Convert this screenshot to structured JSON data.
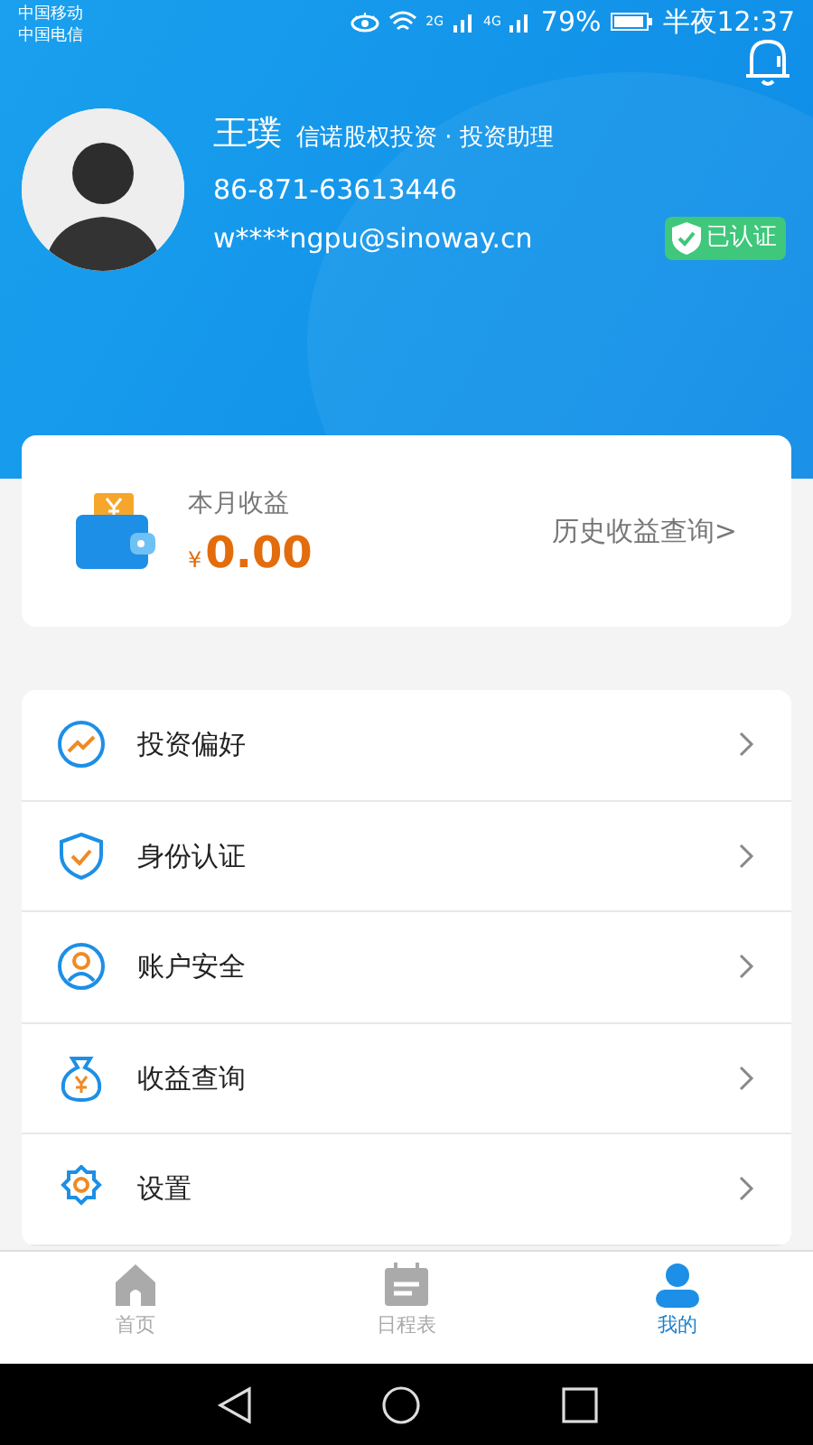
{
  "status_bar": {
    "carriers": [
      "中国移动",
      "中国电信"
    ],
    "network_1": "2G",
    "network_2": "4G",
    "battery": "79%",
    "time": "半夜12:37"
  },
  "profile": {
    "name": "王璞",
    "company": "信诺股权投资 · 投资助理",
    "phone": "86-871-63613446",
    "email": "w****ngpu@sinoway.cn",
    "verified_badge": "已认证"
  },
  "earnings": {
    "label": "本月收益",
    "currency": "¥",
    "amount": "0.00",
    "history_link": "历史收益查询>"
  },
  "menu": [
    {
      "label": "投资偏好"
    },
    {
      "label": "身份认证"
    },
    {
      "label": "账户安全"
    },
    {
      "label": "收益查询"
    },
    {
      "label": "设置"
    }
  ],
  "tabs": [
    {
      "label": "首页",
      "selected": false
    },
    {
      "label": "日程表",
      "selected": false
    },
    {
      "label": "我的",
      "selected": true
    }
  ]
}
